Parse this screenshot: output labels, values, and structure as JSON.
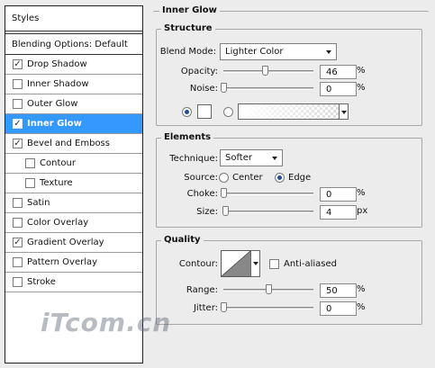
{
  "styles_panel": {
    "header": "Styles",
    "blending_options": "Blending Options: Default",
    "items": [
      {
        "label": "Drop Shadow",
        "checked": true
      },
      {
        "label": "Inner Shadow",
        "checked": false
      },
      {
        "label": "Outer Glow",
        "checked": false
      },
      {
        "label": "Inner Glow",
        "checked": true,
        "selected": true
      },
      {
        "label": "Bevel and Emboss",
        "checked": true
      },
      {
        "label": "Contour",
        "checked": false,
        "sub": true
      },
      {
        "label": "Texture",
        "checked": false,
        "sub": true
      },
      {
        "label": "Satin",
        "checked": false
      },
      {
        "label": "Color Overlay",
        "checked": false
      },
      {
        "label": "Gradient Overlay",
        "checked": true
      },
      {
        "label": "Pattern Overlay",
        "checked": false
      },
      {
        "label": "Stroke",
        "checked": false
      }
    ],
    "check_glyph": "✓"
  },
  "inner_glow": {
    "title": "Inner Glow",
    "structure": {
      "title": "Structure",
      "blend_mode_label": "Blend Mode:",
      "blend_mode_value": "Lighter Color",
      "opacity_label": "Opacity:",
      "opacity_value": "46",
      "opacity_unit": "%",
      "opacity_level": 0.46,
      "noise_label": "Noise:",
      "noise_value": "0",
      "noise_unit": "%",
      "noise_level": 0,
      "fill_mode": "color"
    },
    "elements": {
      "title": "Elements",
      "technique_label": "Technique:",
      "technique_value": "Softer",
      "source_label": "Source:",
      "source_center": "Center",
      "source_edge": "Edge",
      "source_selected": "Edge",
      "choke_label": "Choke:",
      "choke_value": "0",
      "choke_unit": "%",
      "choke_level": 0,
      "size_label": "Size:",
      "size_value": "4",
      "size_unit": "px",
      "size_level": 0.016
    },
    "quality": {
      "title": "Quality",
      "contour_label": "Contour:",
      "anti_aliased_label": "Anti-aliased",
      "anti_aliased_checked": false,
      "range_label": "Range:",
      "range_value": "50",
      "range_unit": "%",
      "range_level": 0.5,
      "jitter_label": "Jitter:",
      "jitter_value": "0",
      "jitter_unit": "%",
      "jitter_level": 0
    }
  },
  "watermark": "iTcom.cn",
  "colors": {
    "selection": "#3399ff",
    "radio_dot": "#1d4e9c",
    "background": "#ececec"
  }
}
